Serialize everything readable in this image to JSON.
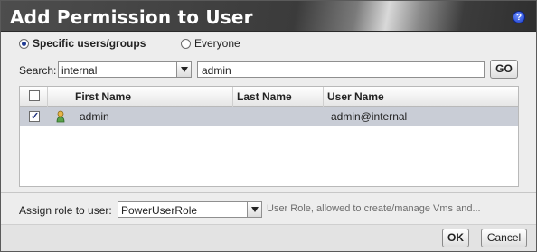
{
  "dialog": {
    "title": "Add Permission to User",
    "help_label": "?"
  },
  "scope": {
    "options": [
      {
        "label": "Specific users/groups",
        "selected": true
      },
      {
        "label": "Everyone",
        "selected": false
      }
    ]
  },
  "search": {
    "label": "Search:",
    "domain_value": "internal",
    "query_value": "admin",
    "go_label": "GO"
  },
  "grid": {
    "columns": [
      "First Name",
      "Last Name",
      "User Name"
    ],
    "rows": [
      {
        "checked": true,
        "first_name": "admin",
        "last_name": "",
        "user_name": "admin@internal"
      }
    ]
  },
  "role": {
    "label": "Assign role to user:",
    "value": "PowerUserRole",
    "description": "User Role, allowed to create/manage Vms and..."
  },
  "footer": {
    "ok_label": "OK",
    "cancel_label": "Cancel"
  },
  "colors": {
    "selected_row": "#c9cdd6",
    "title_text": "#ffffff"
  }
}
